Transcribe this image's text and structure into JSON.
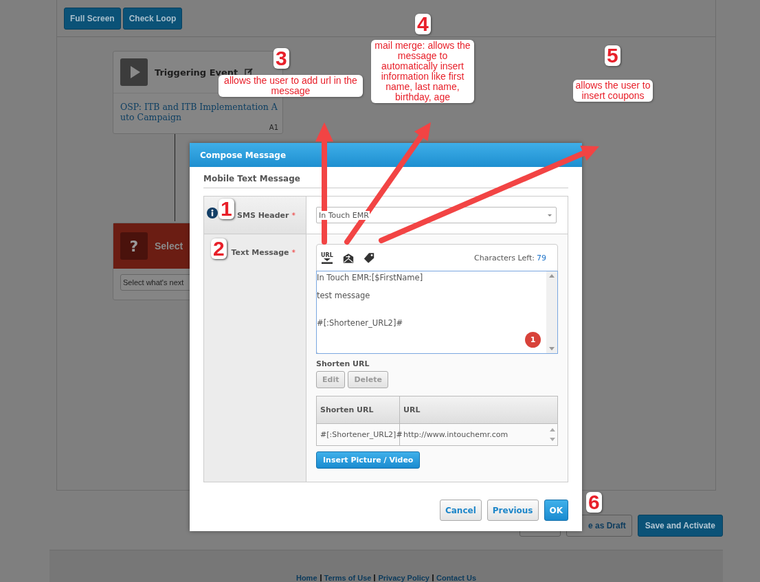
{
  "toolbar": {
    "buttons": [
      "Full Screen",
      "Check Loop"
    ]
  },
  "flow": {
    "nodes": [
      {
        "kind": "trigger",
        "title": "Triggering Event",
        "body": "OSP: ITB and ITB Implementation Auto Campaign",
        "tag": "A1"
      },
      {
        "kind": "choice",
        "icon": "?",
        "title": "Select",
        "placeholder": "Select what's next"
      }
    ]
  },
  "modal": {
    "title": "Compose Message",
    "section": "Mobile Text Message",
    "sms_header": {
      "label": "SMS Header",
      "required_mark": "*",
      "info": true,
      "value": "In Touch EMR"
    },
    "text_message": {
      "label": "Text Message",
      "required_mark": "*",
      "tools": [
        {
          "kind": "url",
          "text": "URL"
        },
        {
          "kind": "mail"
        },
        {
          "kind": "coupon"
        }
      ],
      "chars_label": "Characters Left:",
      "chars_left": "79",
      "lines": [
        {
          "kind": "first",
          "text": "In Touch EMR:[$FirstName]"
        },
        {
          "kind": "after_blank",
          "text": "test message"
        },
        {
          "kind": "after_two_blanks",
          "text": "#[:Shortener_URL2]#"
        }
      ],
      "badge": "1"
    },
    "shorten": {
      "title": "Shorten URL",
      "buttons": [
        {
          "label": "Edit",
          "disabled": true
        },
        {
          "label": "Delete",
          "disabled": true
        }
      ],
      "columns": [
        "Shorten URL",
        "URL"
      ],
      "rows": [
        [
          "#[:Shortener_URL2]#",
          "http://www.intouchemr.com"
        ]
      ]
    },
    "insert_button": "Insert Picture / Video",
    "buttons": [
      {
        "label": "Cancel",
        "kind": "secondary"
      },
      {
        "label": "Previous",
        "kind": "secondary"
      },
      {
        "label": "OK",
        "kind": "primary"
      }
    ]
  },
  "page_actions": [
    {
      "kind": "secondary"
    },
    {
      "kind": "secondary",
      "label": "e as Draft"
    },
    {
      "kind": "primary",
      "label": "Save and Activate"
    }
  ],
  "footer": {
    "links": [
      "Home",
      "Terms of Use",
      "Privacy Policy",
      "Contact Us"
    ]
  },
  "annotations": [
    {
      "number": "1",
      "arrow": false
    },
    {
      "number": "2",
      "arrow": false
    },
    {
      "number": "3",
      "note": "allows the user to add url in the message",
      "arrow": true
    },
    {
      "number": "4",
      "note": "mail merge: allows the message to automatically insert information like first name, last name, birthday, age",
      "arrow": true
    },
    {
      "number": "5",
      "note": "allows the user to insert coupons",
      "arrow": true
    },
    {
      "number": "6",
      "arrow": false
    }
  ]
}
